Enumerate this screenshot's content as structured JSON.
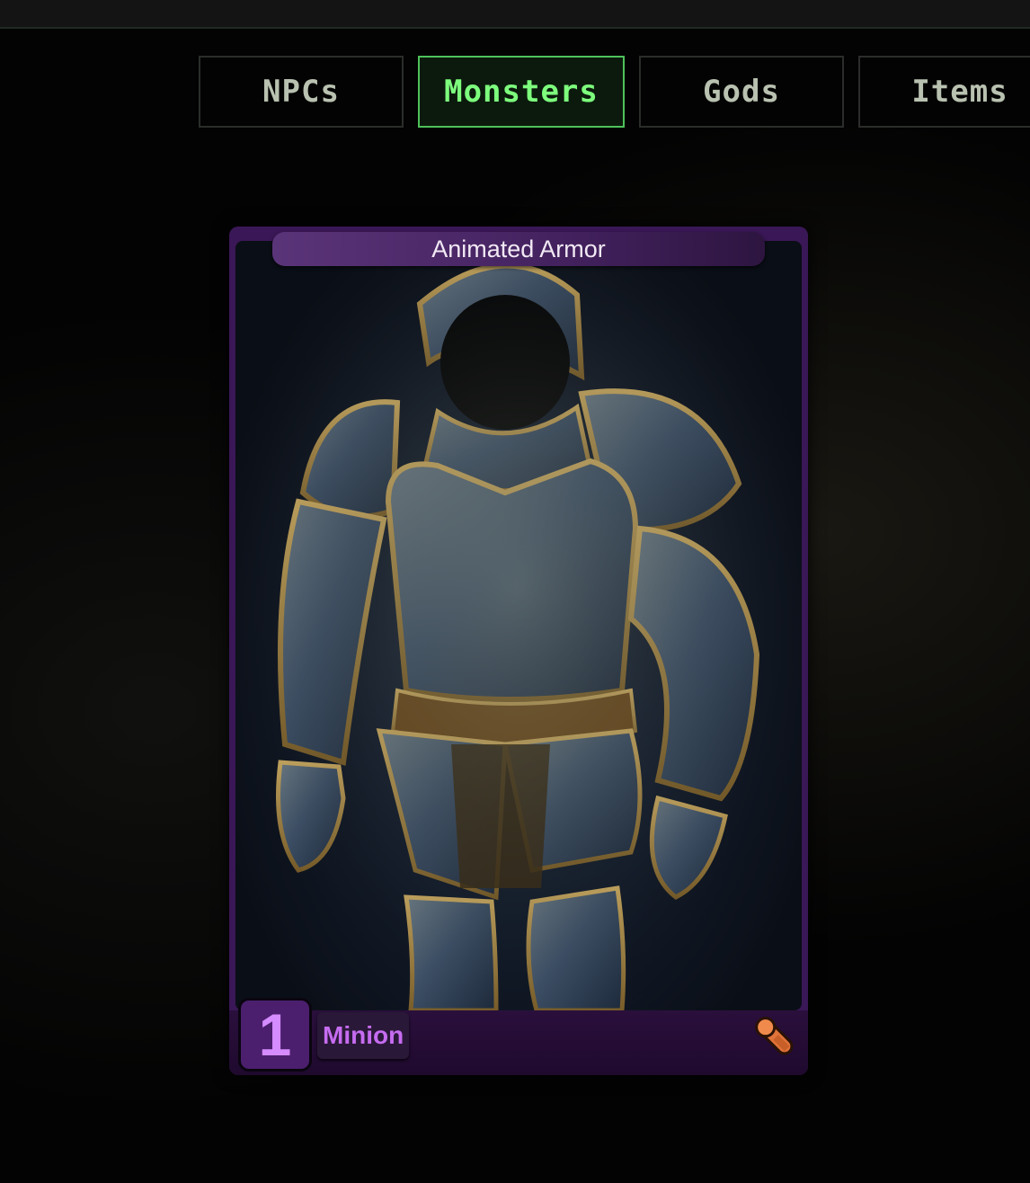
{
  "tabs": [
    {
      "label": "NPCs",
      "active": false
    },
    {
      "label": "Monsters",
      "active": true
    },
    {
      "label": "Gods",
      "active": false
    },
    {
      "label": "Items",
      "active": false
    }
  ],
  "card": {
    "title": "Animated Armor",
    "level": "1",
    "type": "Minion",
    "art_subject": "painted suit of plate armor",
    "pin_icon": "pin-icon"
  },
  "colors": {
    "active_tab_border": "#4ec15a",
    "active_tab_text": "#7dff7d",
    "card_frame": "#3a1756",
    "type_text": "#c56cf0"
  }
}
